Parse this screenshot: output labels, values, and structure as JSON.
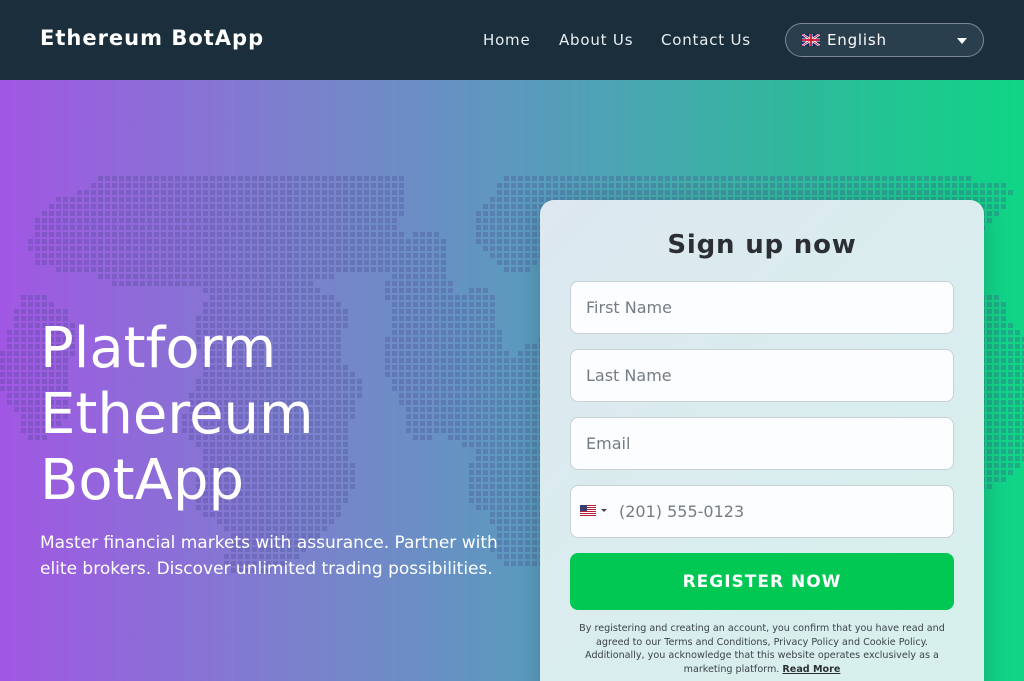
{
  "header": {
    "brand": "Ethereum BotApp",
    "nav": [
      "Home",
      "About Us",
      "Contact Us"
    ],
    "language": "English"
  },
  "hero": {
    "title_lines": [
      "Platform",
      "Ethereum",
      "BotApp"
    ],
    "subtitle": "Master financial markets with assurance. Partner with elite brokers. Discover unlimited trading possibilities."
  },
  "signup": {
    "title": "Sign up now",
    "first_name_placeholder": "First Name",
    "last_name_placeholder": "Last Name",
    "email_placeholder": "Email",
    "phone_placeholder": "(201) 555-0123",
    "register_label": "REGISTER NOW",
    "disclaimer": "By registering and creating an account, you confirm that you have read and agreed to our Terms and Conditions, Privacy Policy and Cookie Policy. Additionally, you acknowledge that this website operates exclusively as a marketing platform.",
    "read_more": "Read More"
  },
  "icons": {
    "language_flag": "uk-flag-icon",
    "phone_flag": "us-flag-icon",
    "caret": "chevron-down-icon"
  },
  "colors": {
    "navbar": "#1b2e3c",
    "gradient_start": "#a157e3",
    "gradient_end": "#0fd585",
    "register_button": "#00c853"
  }
}
